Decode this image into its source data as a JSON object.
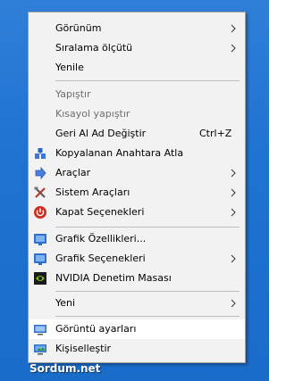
{
  "context_menu": {
    "items": [
      {
        "label": "Görünüm",
        "submenu": true,
        "enabled": true
      },
      {
        "label": "Sıralama ölçütü",
        "submenu": true,
        "enabled": true
      },
      {
        "label": "Yenile",
        "submenu": false,
        "enabled": true
      },
      {
        "label": "Yapıştır",
        "submenu": false,
        "enabled": false
      },
      {
        "label": "Kısayol yapıştır",
        "submenu": false,
        "enabled": false
      },
      {
        "label": "Geri Al Ad Değiştir",
        "shortcut": "Ctrl+Z",
        "submenu": false,
        "enabled": true
      },
      {
        "label": "Kopyalanan Anahtara Atla",
        "icon": "registry-jump-icon",
        "submenu": false,
        "enabled": true
      },
      {
        "label": "Araçlar",
        "icon": "tools-icon",
        "submenu": true,
        "enabled": true
      },
      {
        "label": "Sistem Araçları",
        "icon": "system-tools-icon",
        "submenu": true,
        "enabled": true
      },
      {
        "label": "Kapat Seçenekleri",
        "icon": "power-icon",
        "submenu": true,
        "enabled": true
      },
      {
        "label": "Grafik Özellikleri...",
        "icon": "intel-graphics-icon",
        "submenu": false,
        "enabled": true
      },
      {
        "label": "Grafik Seçenekleri",
        "icon": "intel-graphics-icon",
        "submenu": true,
        "enabled": true
      },
      {
        "label": "NVIDIA Denetim Masası",
        "icon": "nvidia-icon",
        "submenu": false,
        "enabled": true
      },
      {
        "label": "Yeni",
        "submenu": true,
        "enabled": true
      },
      {
        "label": "Görüntü ayarları",
        "icon": "display-icon",
        "submenu": false,
        "enabled": true,
        "highlighted": true
      },
      {
        "label": "Kişiselleştir",
        "icon": "personalize-icon",
        "submenu": false,
        "enabled": true
      }
    ]
  },
  "watermark": "Sordum.net",
  "colors": {
    "desktop": "#1f73d1",
    "menu_bg": "#f2f2f2",
    "highlight": "#ffffff",
    "disabled_text": "#6d6d6d"
  }
}
